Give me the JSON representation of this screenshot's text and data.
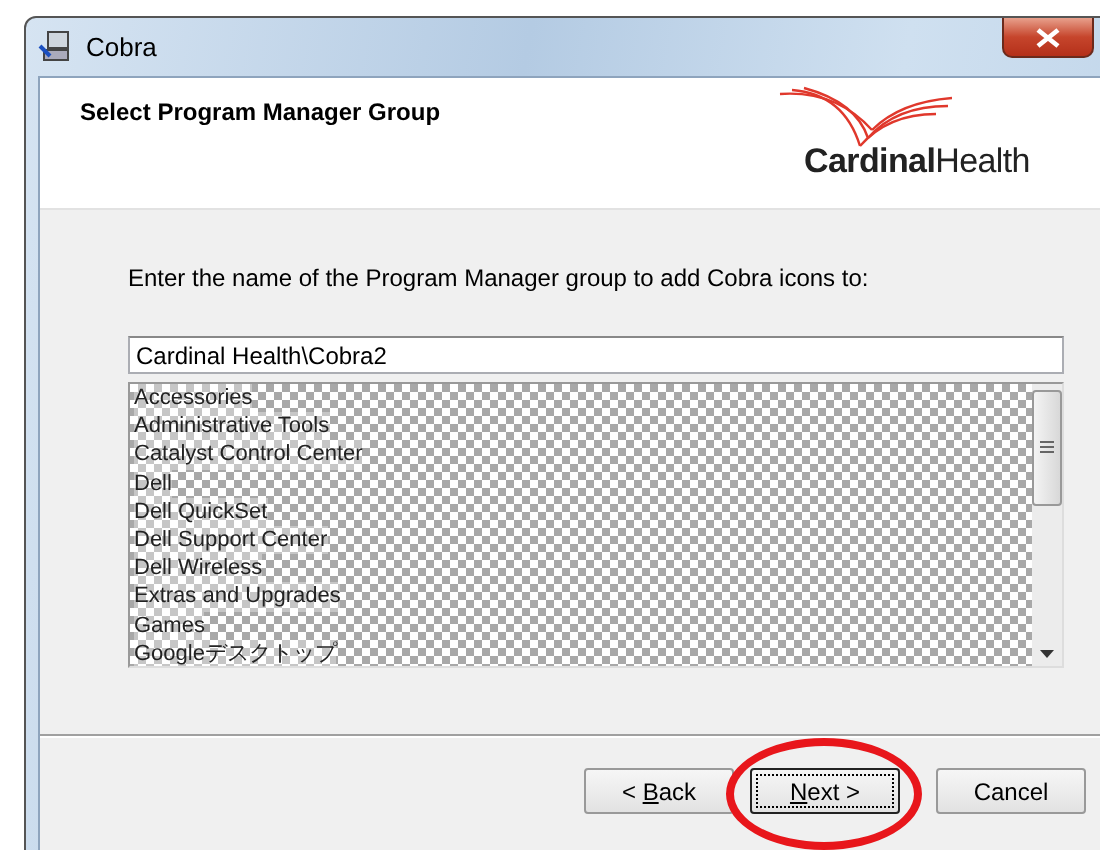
{
  "window": {
    "title": "Cobra"
  },
  "header": {
    "title": "Select Program Manager Group",
    "logo": "**Cardinal**Health"
  },
  "instruction": "Enter the name of the Program Manager group to add Cobra icons to:",
  "group_field": {
    "value": "Cardinal Health\\Cobra2"
  },
  "group_list": [
    {
      "label": "Accessories"
    },
    {
      "label": "Administrative Tools"
    },
    {
      "label": "Catalyst Control Center"
    },
    {
      "label": "Dell"
    },
    {
      "label": "Dell QuickSet"
    },
    {
      "label": "Dell Support Center"
    },
    {
      "label": "Dell Wireless"
    },
    {
      "label": "Extras and Upgrades"
    },
    {
      "label": "Games"
    },
    {
      "label": "Googleデスクトップ"
    }
  ],
  "buttons": [
    {
      "label_parts": [
        {
          "text": "< ",
          "underlined": false
        },
        {
          "text": "B",
          "underlined": true
        },
        {
          "text": "ack",
          "underlined": false
        }
      ],
      "focused": false,
      "highlighted": false
    },
    {
      "label_parts": [
        {
          "text": "N",
          "underlined": true
        },
        {
          "text": "ext >",
          "underlined": false
        }
      ],
      "focused": true,
      "highlighted": true
    },
    {
      "label_parts": [
        {
          "text": "Cancel",
          "underlined": false
        }
      ],
      "focused": false,
      "highlighted": false
    }
  ]
}
